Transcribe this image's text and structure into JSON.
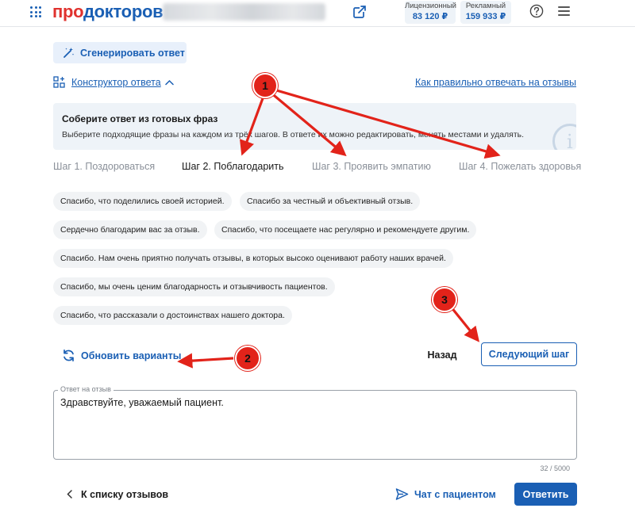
{
  "header": {
    "logo_part1": "про",
    "logo_part2": "докторов",
    "balances": [
      {
        "label": "Лицензионный",
        "value": "83 120 ₽"
      },
      {
        "label": "Рекламный",
        "value": "159 933 ₽"
      }
    ]
  },
  "toolbar": {
    "generate_label": "Сгенерировать ответ",
    "constructor_label": "Конструктор ответа",
    "howto_link": "Как правильно отвечать на отзывы"
  },
  "info": {
    "title": "Соберите ответ из готовых фраз",
    "text": "Выберите подходящие фразы на каждом из трёх шагов. В ответе их можно редактировать, менять местами и удалять.",
    "icon_glyph": "i"
  },
  "steps": [
    {
      "label": "Шаг 1. Поздороваться",
      "active": false
    },
    {
      "label": "Шаг 2. Поблагодарить",
      "active": true
    },
    {
      "label": "Шаг 3. Проявить эмпатию",
      "active": false
    },
    {
      "label": "Шаг 4. Пожелать здоровья",
      "active": false
    }
  ],
  "phrases": [
    "Спасибо, что поделились своей историей.",
    "Спасибо за честный и объективный отзыв.",
    "Сердечно благодарим вас за отзыв.",
    "Спасибо, что посещаете нас регулярно и рекомендуете другим.",
    "Спасибо. Нам очень приятно получать отзывы, в которых высоко оценивают работу наших врачей.",
    "Спасибо, мы очень ценим благодарность и отзывчивость пациентов.",
    "Спасибо, что рассказали о достоинствах нашего доктора."
  ],
  "actions": {
    "refresh_label": "Обновить варианты",
    "back_label": "Назад",
    "next_label": "Следующий шаг"
  },
  "reply": {
    "label": "Ответ на отзыв",
    "value": "Здравствуйте, уважаемый пациент.",
    "counter": "32 / 5000"
  },
  "footer": {
    "to_list_label": "К списку отзывов",
    "chat_label": "Чат с пациентом",
    "reply_button": "Ответить"
  },
  "annotations": {
    "badges": [
      "1",
      "2",
      "3"
    ],
    "color": "#e2231a"
  },
  "colors": {
    "accent": "#1a5fb4",
    "brand_red": "#e0322e",
    "chip_bg": "#f1f3f5",
    "info_bg": "#eef3f8"
  }
}
